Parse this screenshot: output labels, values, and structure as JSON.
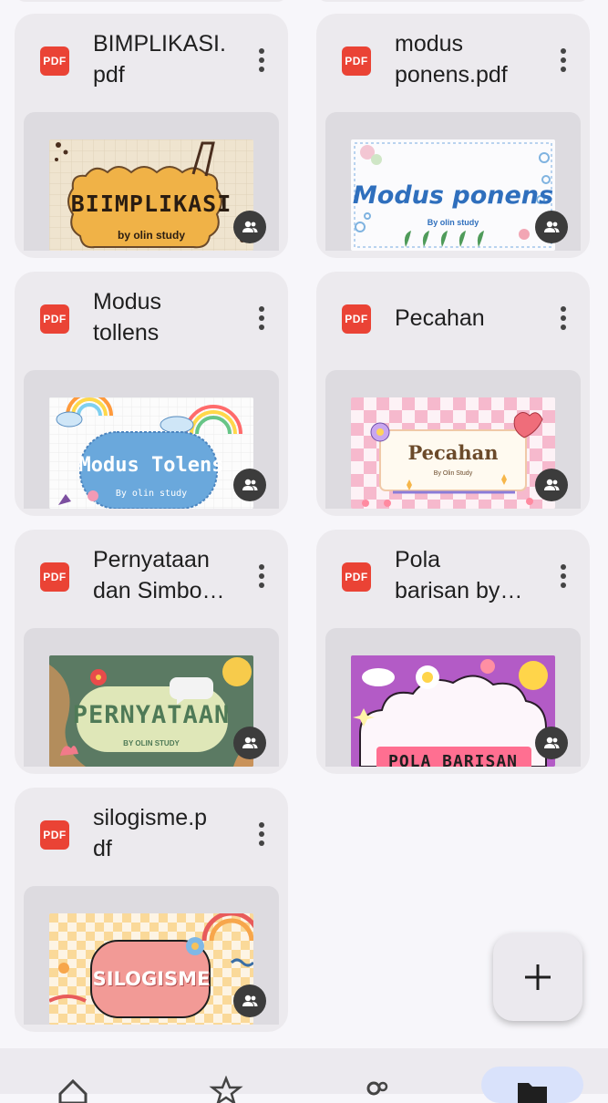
{
  "files": [
    {
      "name": "BIMPLIKASI.\npdf",
      "type_badge": "PDF",
      "thumb_title": "BIIMPLIKASI",
      "thumb_sub": "by olin study"
    },
    {
      "name": "modus\nponens.pdf",
      "type_badge": "PDF",
      "thumb_title": "Modus ponens",
      "thumb_sub": "By olin study"
    },
    {
      "name": "Modus\ntollens",
      "type_badge": "PDF",
      "thumb_title": "Modus Tolens",
      "thumb_sub": "By olin study"
    },
    {
      "name": "Pecahan",
      "type_badge": "PDF",
      "thumb_title": "Pecahan",
      "thumb_sub": "By Olin Study"
    },
    {
      "name": "Pernyataan\ndan Simbo…",
      "type_badge": "PDF",
      "thumb_title": "PERNYATAAN",
      "thumb_sub": "BY OLIN STUDY"
    },
    {
      "name": "Pola\nbarisan by…",
      "type_badge": "PDF",
      "thumb_title": "POLA BARISAN",
      "thumb_sub": ""
    },
    {
      "name": "silogisme.p\ndf",
      "type_badge": "PDF",
      "thumb_title": "SILOGISME",
      "thumb_sub": ""
    }
  ],
  "fab": {
    "icon": "plus-icon"
  },
  "bottom_nav": {
    "items": [
      {
        "icon": "home-icon"
      },
      {
        "icon": "star-icon"
      },
      {
        "icon": "shared-icon"
      },
      {
        "icon": "folder-icon",
        "active": true
      }
    ]
  },
  "colors": {
    "pdf_red": "#ea4335",
    "card_bg": "#eceaee",
    "active_nav": "#d9e2fb"
  }
}
